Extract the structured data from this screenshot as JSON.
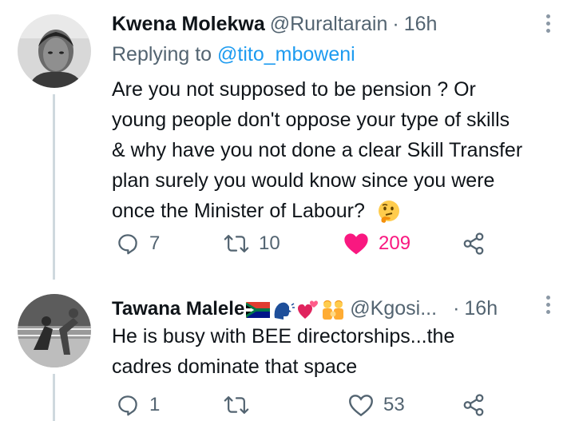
{
  "tweets": [
    {
      "display_name": "Kwena Molekwa",
      "handle": "@Ruraltarain",
      "separator": "·",
      "time": "16h",
      "replying_prefix": "Replying to",
      "replying_to": "@tito_mboweni",
      "text_lines": [
        "Are you not supposed to be pension ? Or",
        "young people don't oppose your type of skills",
        "& why have you not done a clear Skill Transfer",
        "plan surely you would know since you were",
        "once  the Minister of Labour?"
      ],
      "trailing_emoji": "thinking-face",
      "replies": "7",
      "retweets": "10",
      "likes": "209",
      "liked": true
    },
    {
      "display_name": "Tawana Malele",
      "name_emojis": [
        "south-africa-flag",
        "speaking-head",
        "two-hearts",
        "family"
      ],
      "handle": "@Kgosi...",
      "separator": "·",
      "time": "16h",
      "text_lines": [
        "He is busy with BEE directorships...the",
        "cadres dominate that space"
      ],
      "replies": "1",
      "retweets": "",
      "likes": "53",
      "liked": false
    }
  ],
  "colors": {
    "text": "#0f1419",
    "secondary": "#536471",
    "link": "#1d9bf0",
    "like": "#f91880",
    "thread_line": "#cfd9de"
  }
}
